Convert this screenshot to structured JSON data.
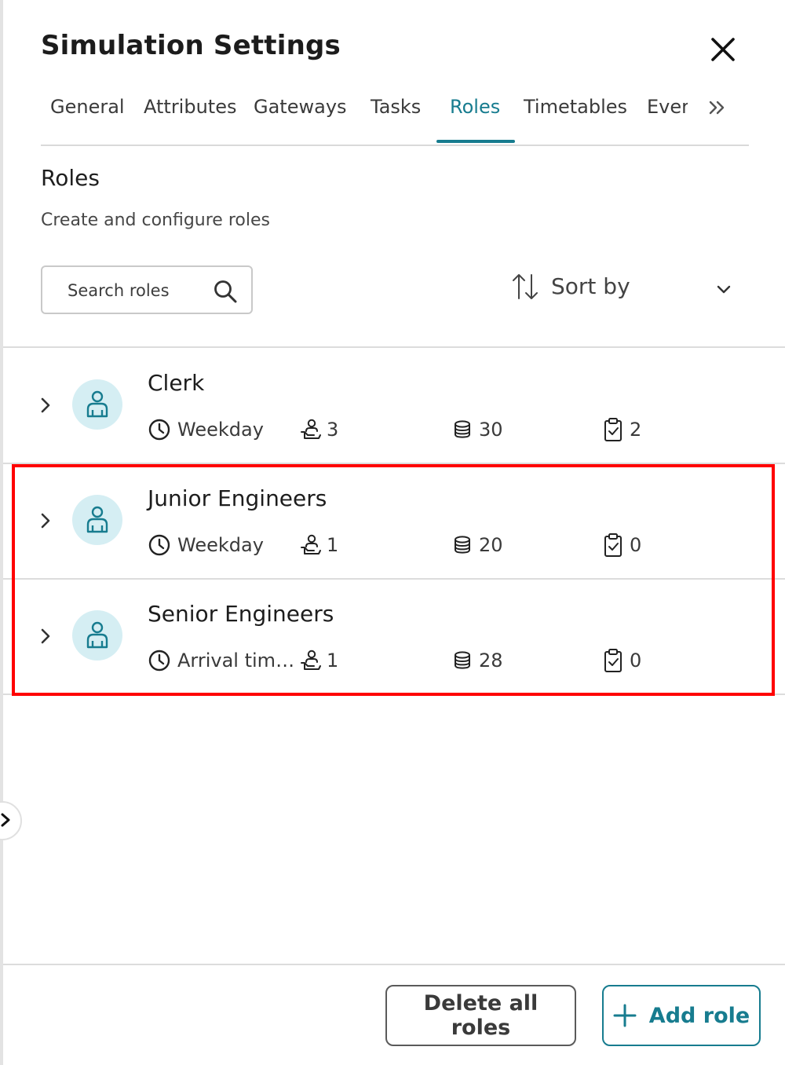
{
  "panel": {
    "title": "Simulation Settings"
  },
  "tabs": [
    {
      "label": "General",
      "active": false
    },
    {
      "label": "Attributes",
      "active": false
    },
    {
      "label": "Gateways",
      "active": false
    },
    {
      "label": "Tasks",
      "active": false
    },
    {
      "label": "Roles",
      "active": true
    },
    {
      "label": "Timetables",
      "active": false
    },
    {
      "label": "Ever",
      "active": false
    }
  ],
  "section": {
    "title": "Roles",
    "subtitle": "Create and configure roles"
  },
  "search": {
    "placeholder": "Search roles",
    "value": ""
  },
  "sort": {
    "label": "Sort by"
  },
  "roles": [
    {
      "name": "Clerk",
      "timetable": "Weekday",
      "count": "3",
      "cost": "30",
      "tasks": "2"
    },
    {
      "name": "Junior Engineers",
      "timetable": "Weekday",
      "count": "1",
      "cost": "20",
      "tasks": "0"
    },
    {
      "name": "Senior Engineers",
      "timetable": "Arrival time...",
      "count": "1",
      "cost": "28",
      "tasks": "0"
    }
  ],
  "footer": {
    "delete_label": "Delete all roles",
    "add_label": "Add role"
  },
  "colors": {
    "accent": "#177c8f",
    "avatar_bg": "#d5eef3",
    "highlight": "#ff0000"
  },
  "icons": {
    "close": "close-icon",
    "more_tabs": "double-chevron-right-icon",
    "search": "search-icon",
    "sort": "sort-arrows-icon",
    "dropdown": "chevron-down-icon",
    "expand": "chevron-right-icon",
    "role": "person-icon",
    "timetable": "clock-icon",
    "count": "person-hand-icon",
    "cost": "coins-icon",
    "tasks": "clipboard-check-icon",
    "add": "plus-icon"
  }
}
